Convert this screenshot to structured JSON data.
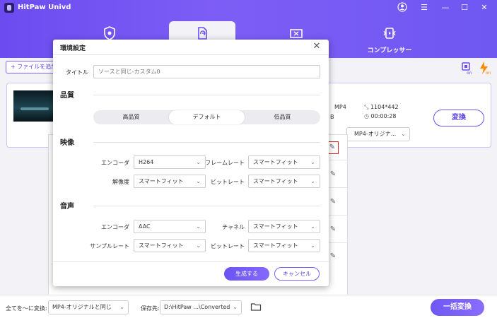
{
  "app": {
    "title": "HitPaw Univd"
  },
  "nav": {
    "tabs": [
      {
        "label": "",
        "icon": "shield-icon"
      },
      {
        "label": "",
        "icon": "convert-file-icon",
        "active": true
      },
      {
        "label": "",
        "icon": "crop-icon"
      },
      {
        "label": "コンプレッサー",
        "icon": "compressor-icon"
      }
    ]
  },
  "toolbar": {
    "add_file_label": "+ ファイルを追加"
  },
  "file": {
    "format": "MP4",
    "resolution": "1104*442",
    "size_suffix": "B",
    "duration": "00:00:28",
    "convert_label": "変換",
    "output_format": "MP4-オリジナ..."
  },
  "dialog": {
    "title": "環境設定",
    "title_field_label": "タイトル",
    "title_placeholder": "ソースと同じ-カスタム0",
    "quality": {
      "heading": "品質",
      "options": [
        "高品質",
        "デフォルト",
        "低品質"
      ],
      "selected": "デフォルト"
    },
    "video": {
      "heading": "映像",
      "encoder_label": "エンコーダ",
      "encoder_value": "H264",
      "framerate_label": "フレームレート",
      "framerate_value": "スマートフィット",
      "resolution_label": "解像度",
      "resolution_value": "スマートフィット",
      "bitrate_label": "ビットレート",
      "bitrate_value": "スマートフィット"
    },
    "audio": {
      "heading": "音声",
      "encoder_label": "エンコーダ",
      "encoder_value": "AAC",
      "channel_label": "チャネル",
      "channel_value": "スマートフィット",
      "samplerate_label": "サンプルレート",
      "samplerate_value": "スマートフィット",
      "bitrate_label": "ビットレート",
      "bitrate_value": "スマートフィット"
    },
    "generate_label": "生成する",
    "cancel_label": "キャンセル"
  },
  "bottom": {
    "convert_all_to_label": "全てを～に変換:",
    "convert_all_to_value": "MP4-オリジナルと同じ",
    "save_to_label": "保存先:",
    "save_to_value": "D:\\HitPaw ...\\Converted",
    "convert_all_button": "一括変換"
  },
  "colors": {
    "accent": "#6c4cf0",
    "highlight_red": "#e02424"
  }
}
